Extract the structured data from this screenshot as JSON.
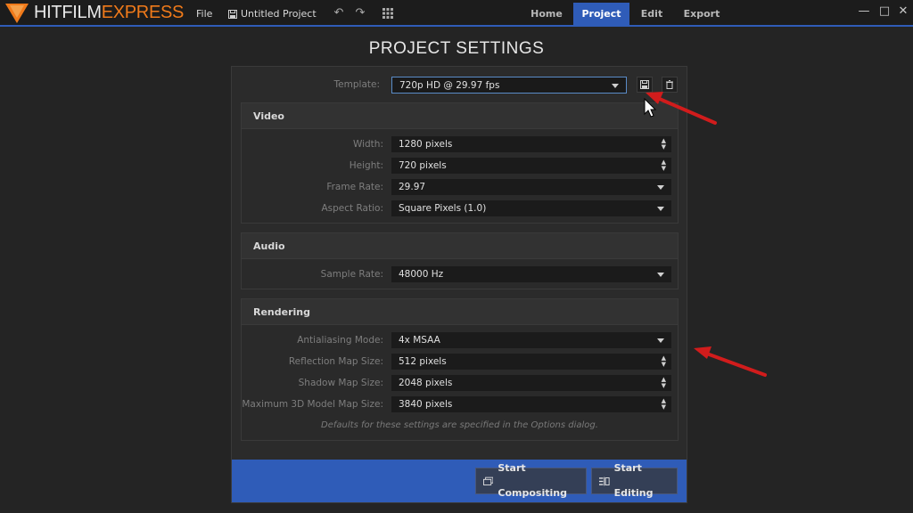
{
  "app": {
    "brand_part1": "HITFILM",
    "brand_part2": "EXPRESS",
    "menu_file": "File",
    "project_name": "Untitled Project"
  },
  "tabs": [
    {
      "label": "Home",
      "active": false
    },
    {
      "label": "Project",
      "active": true
    },
    {
      "label": "Edit",
      "active": false
    },
    {
      "label": "Export",
      "active": false
    }
  ],
  "window_controls": {
    "minimize": "—",
    "maximize": "□",
    "close": "✕"
  },
  "page_title": "PROJECT SETTINGS",
  "template": {
    "label": "Template:",
    "value": "720p HD @ 29.97 fps"
  },
  "video": {
    "title": "Video",
    "width": {
      "label": "Width:",
      "value": "1280 pixels"
    },
    "height": {
      "label": "Height:",
      "value": "720 pixels"
    },
    "frame_rate": {
      "label": "Frame Rate:",
      "value": "29.97"
    },
    "aspect_ratio": {
      "label": "Aspect Ratio:",
      "value": "Square Pixels (1.0)"
    }
  },
  "audio": {
    "title": "Audio",
    "sample_rate": {
      "label": "Sample Rate:",
      "value": "48000 Hz"
    }
  },
  "rendering": {
    "title": "Rendering",
    "antialiasing": {
      "label": "Antialiasing Mode:",
      "value": "4x MSAA"
    },
    "reflection": {
      "label": "Reflection Map Size:",
      "value": "512 pixels"
    },
    "shadow": {
      "label": "Shadow Map Size:",
      "value": "2048 pixels"
    },
    "model3d": {
      "label": "Maximum 3D Model Map Size:",
      "value": "3840 pixels"
    },
    "note": "Defaults for these settings are specified in the Options dialog."
  },
  "footer": {
    "start_compositing": "Start Compositing",
    "start_editing": "Start Editing"
  },
  "colors": {
    "accent": "#2f5cb8",
    "brand_orange": "#f07a1a",
    "annotation_red": "#d11c1c"
  }
}
